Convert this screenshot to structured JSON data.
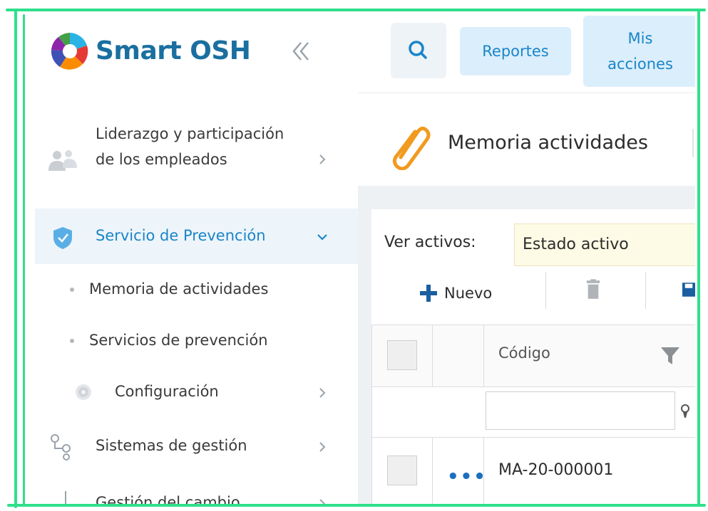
{
  "sidebar": {
    "brand": "Smart OSH",
    "items": [
      {
        "label": "Liderazgo y participación de los empleados"
      },
      {
        "label": "Servicio de Prevención",
        "active": true
      },
      {
        "label": "Configuración"
      },
      {
        "label": "Sistemas de gestión"
      },
      {
        "label": "Gestión del cambio"
      }
    ],
    "subitems": [
      {
        "label": "Memoria de actividades"
      },
      {
        "label": "Servicios de prevención"
      }
    ]
  },
  "topbar": {
    "reportes_label": "Reportes",
    "mis_acciones_label": "Mis acciones"
  },
  "page": {
    "title": "Memoria actividades"
  },
  "filter": {
    "label": "Ver activos:",
    "selected": "Estado activo"
  },
  "toolbar": {
    "new_label": "Nuevo"
  },
  "table": {
    "columns": [
      "Código"
    ],
    "rows": [
      {
        "code": "MA-20-000001"
      }
    ]
  },
  "colors": {
    "accent": "#1a85c8",
    "frame": "#2ee08a",
    "active_bg": "#eef5fa",
    "select_bg": "#fdfbe5",
    "brand_text": "#1a6fa0",
    "clip_orange": "#f29a1e"
  },
  "icons": [
    "logo-icon",
    "collapse-icon",
    "people-icon",
    "shield-icon",
    "gear-icon",
    "sistemas-icon",
    "search-icon",
    "paperclip-icon",
    "plus-icon",
    "trash-icon",
    "save-icon",
    "filter-icon",
    "funnel-small-icon",
    "more-dots-icon",
    "chevron-right-icon",
    "chevron-down-icon"
  ]
}
